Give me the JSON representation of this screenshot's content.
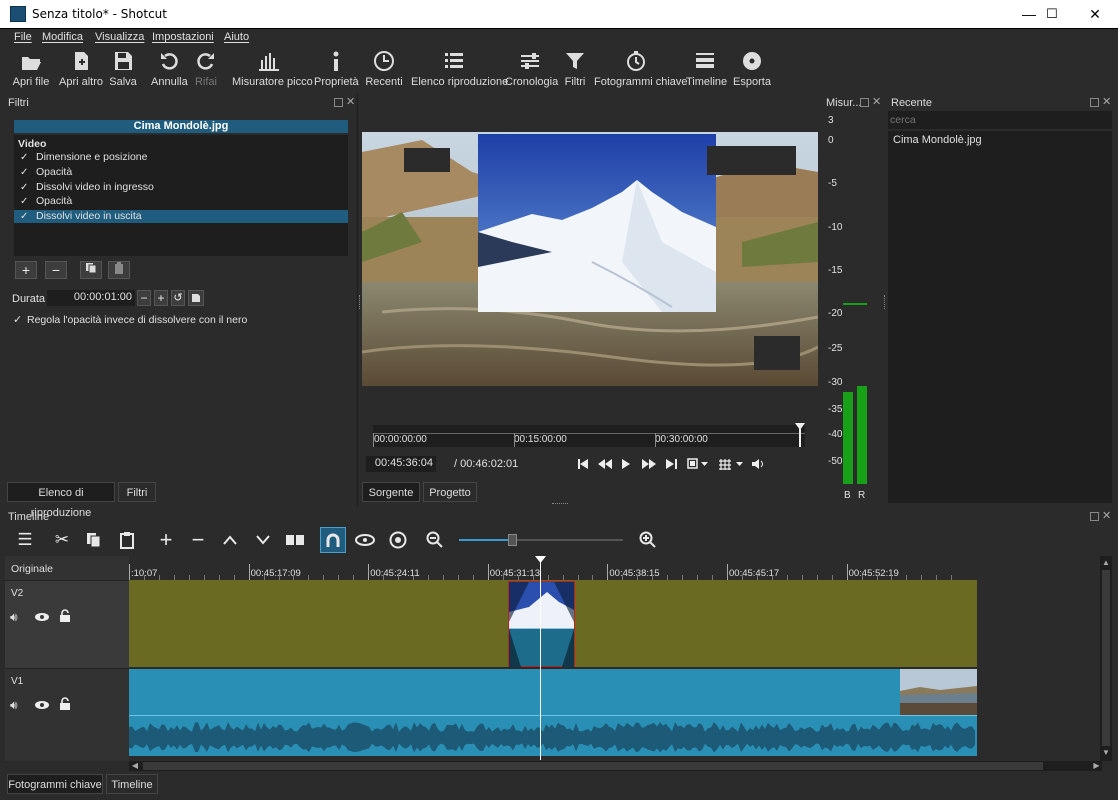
{
  "window": {
    "title": "Senza titolo* - Shotcut",
    "minimize": "—",
    "maximize": "☐",
    "close": "✕"
  },
  "menu": [
    "File",
    "Modifica",
    "Visualizza",
    "Impostazioni",
    "Aiuto"
  ],
  "toolbar": {
    "open_file": "Apri file",
    "open_other": "Apri altro",
    "save": "Salva",
    "undo": "Annulla",
    "redo": "Rifai",
    "peak_meter": "Misuratore picco",
    "properties": "Proprietà",
    "recent": "Recenti",
    "playlist": "Elenco riproduzione",
    "history": "Cronologia",
    "filters": "Filtri",
    "keyframes": "Fotogrammi chiave",
    "timeline": "Timeline",
    "export": "Esporta"
  },
  "filters_panel": {
    "title": "Filtri",
    "clip_name": "Cima Mondolè.jpg",
    "group": "Video",
    "items": [
      {
        "label": "Dimensione e posizione",
        "check": "✓"
      },
      {
        "label": "Opacità",
        "check": "✓"
      },
      {
        "label": "Dissolvi video in ingresso",
        "check": "✓"
      },
      {
        "label": "Opacità",
        "check": "✓"
      },
      {
        "label": "Dissolvi video in uscita",
        "check": "✓"
      }
    ],
    "duration_label": "Durata",
    "duration_value": "00:00:01:00",
    "opacity_option": "Regola l'opacità invece di dissolvere con il nero",
    "opacity_check": "✓",
    "tabs": [
      "Elenco di riproduzione",
      "Filtri"
    ]
  },
  "player": {
    "scrub_ticks": [
      "00:00:00:00",
      "00:15:00:00",
      "00:30:00:00"
    ],
    "position": "00:45:36:04",
    "duration": "/ 00:46:02:01",
    "tabs": [
      "Sorgente",
      "Progetto"
    ]
  },
  "meter": {
    "title": "Misur...",
    "scale": [
      "3",
      "0",
      "-5",
      "-10",
      "-15",
      "-20",
      "-25",
      "-30",
      "-35",
      "-40",
      "-50"
    ],
    "channels": [
      "B",
      "R"
    ],
    "level_left": 0.77,
    "level_right": 0.82
  },
  "recent_panel": {
    "title": "Recente",
    "search_placeholder": "cerca",
    "items": [
      "Cima Mondolè.jpg"
    ]
  },
  "timeline": {
    "title": "Timeline",
    "header_label": "Originale",
    "ticks": [
      ":10:07",
      "00:45:17:09",
      "00:45:24:11",
      "00:45:31:13",
      "00:45:38:15",
      "00:45:45:17",
      "00:45:52:19"
    ],
    "tracks": [
      {
        "name": "V2"
      },
      {
        "name": "V1"
      }
    ],
    "zoom_level": 0.3
  },
  "bottom_tabs": [
    "Fotogrammi chiave",
    "Timeline"
  ],
  "colors": {
    "accent": "#1f5c7d",
    "v2_track": "#6a6a22",
    "v1_track": "#2a8fb4",
    "meter_green": "#18a018"
  }
}
